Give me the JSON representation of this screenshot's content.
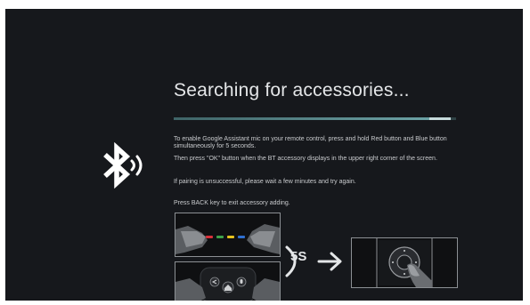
{
  "title": "Searching for accessories...",
  "progress": {
    "fraction": 0.98
  },
  "instructions": [
    "To enable Google Assistant mic on your remote control, press and hold Red button and Blue button simultaneously for 5 seconds.",
    "Then press \"OK\" button when the BT accessory displays in the upper right corner of the screen.",
    "If pairing is unsuccessful, please wait a few minutes and try again."
  ],
  "back_note": "Press BACK key to exit accessory adding.",
  "hold_duration_label": "5S",
  "icons": {
    "bluetooth": "bluetooth-signal-icon",
    "arrow": "arrow-right-icon",
    "hold": "timer-arc-icon"
  },
  "colors": {
    "background": "#16181c",
    "text": "#e4e6e8",
    "progress": "#6fa7aa",
    "red_button": "#d8323a",
    "green_button": "#3ea24a",
    "yellow_button": "#e6c21e",
    "blue_button": "#2f6fd0"
  }
}
